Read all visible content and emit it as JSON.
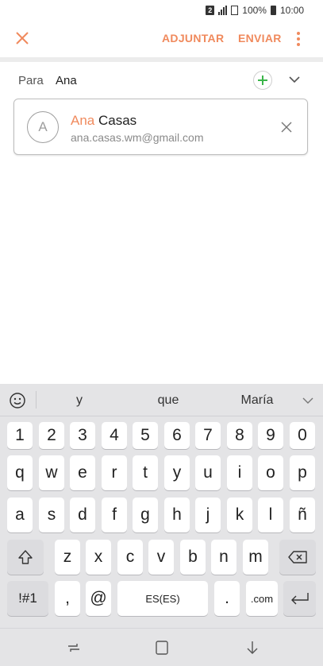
{
  "status_bar": {
    "sim_label": "2",
    "battery_text": "100%",
    "time": "10:00"
  },
  "app_bar": {
    "close_icon": "close-icon",
    "attach_label": "ADJUNTAR",
    "send_label": "ENVIAR",
    "more_icon": "more-vert-icon",
    "accent_color": "#f08a5d"
  },
  "recipient": {
    "label": "Para",
    "value": "Ana",
    "add_icon": "add-contact-icon",
    "expand_icon": "chevron-down-icon",
    "add_color": "#3bb54a"
  },
  "suggestion": {
    "avatar_initial": "A",
    "name_match": "Ana",
    "name_rest": " Casas",
    "email": "ana.casas.wm@gmail.com",
    "dismiss_icon": "close-icon"
  },
  "keyboard": {
    "suggestions": [
      "y",
      "que",
      "María"
    ],
    "number_row": [
      "1",
      "2",
      "3",
      "4",
      "5",
      "6",
      "7",
      "8",
      "9",
      "0"
    ],
    "row1": [
      "q",
      "w",
      "e",
      "r",
      "t",
      "y",
      "u",
      "i",
      "o",
      "p"
    ],
    "row2": [
      "a",
      "s",
      "d",
      "f",
      "g",
      "h",
      "j",
      "k",
      "l",
      "ñ"
    ],
    "row3": [
      "z",
      "x",
      "c",
      "v",
      "b",
      "n",
      "m"
    ],
    "symbols_label": "!#1",
    "comma": ",",
    "at": "@",
    "space_label": "ES(ES)",
    "period": ".",
    "dotcom": ".com"
  },
  "nav_bar": {
    "recents_icon": "recents-icon",
    "home_icon": "home-icon",
    "back_icon": "back-arrow-icon"
  }
}
